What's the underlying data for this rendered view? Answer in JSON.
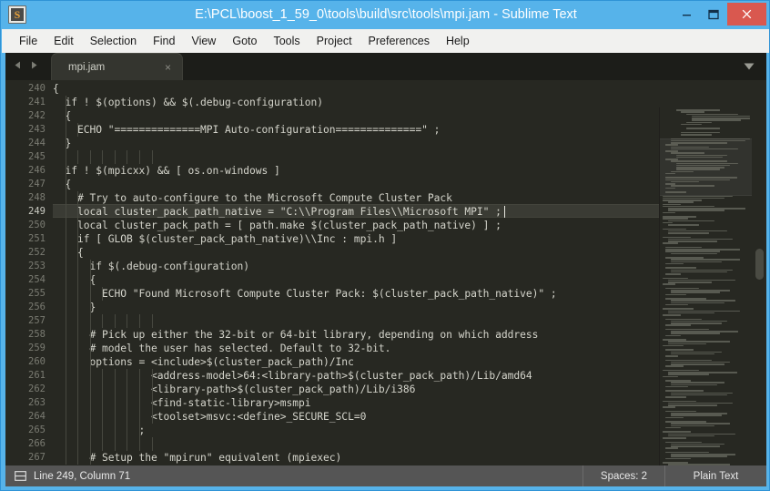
{
  "window": {
    "title": "E:\\PCL\\boost_1_59_0\\tools\\build\\src\\tools\\mpi.jam - Sublime Text",
    "app_icon_glyph": "S",
    "accent_color": "#56b3ea",
    "close_button_color": "#d9584f",
    "controls": {
      "minimize": "minimize-icon",
      "maximize": "maximize-icon",
      "close": "close-icon"
    }
  },
  "menubar": {
    "items": [
      {
        "label": "File"
      },
      {
        "label": "Edit"
      },
      {
        "label": "Selection"
      },
      {
        "label": "Find"
      },
      {
        "label": "View"
      },
      {
        "label": "Goto"
      },
      {
        "label": "Tools"
      },
      {
        "label": "Project"
      },
      {
        "label": "Preferences"
      },
      {
        "label": "Help"
      }
    ]
  },
  "tabbar": {
    "prev_icon": "triangle-left-icon",
    "next_icon": "triangle-right-icon",
    "menu_icon": "chevron-down-icon",
    "tabs": [
      {
        "label": "mpi.jam",
        "close_glyph": "×",
        "active": true
      }
    ]
  },
  "editor": {
    "first_line_number": 240,
    "active_line_number": 249,
    "background_color": "#272822",
    "text_color": "#d4d4cb",
    "lines": [
      {
        "n": 240,
        "text": "{"
      },
      {
        "n": 241,
        "text": "  if ! $(options) && $(.debug-configuration)"
      },
      {
        "n": 242,
        "text": "  {"
      },
      {
        "n": 243,
        "text": "    ECHO \"==============MPI Auto-configuration==============\" ;"
      },
      {
        "n": 244,
        "text": "  }"
      },
      {
        "n": 245,
        "text": ""
      },
      {
        "n": 246,
        "text": "  if ! $(mpicxx) && [ os.on-windows ]"
      },
      {
        "n": 247,
        "text": "  {"
      },
      {
        "n": 248,
        "text": "    # Try to auto-configure to the Microsoft Compute Cluster Pack"
      },
      {
        "n": 249,
        "text": "    local cluster_pack_path_native = \"C:\\\\Program Files\\\\Microsoft MPI\" ;"
      },
      {
        "n": 250,
        "text": "    local cluster_pack_path = [ path.make $(cluster_pack_path_native) ] ;"
      },
      {
        "n": 251,
        "text": "    if [ GLOB $(cluster_pack_path_native)\\\\Inc : mpi.h ]"
      },
      {
        "n": 252,
        "text": "    {"
      },
      {
        "n": 253,
        "text": "      if $(.debug-configuration)"
      },
      {
        "n": 254,
        "text": "      {"
      },
      {
        "n": 255,
        "text": "        ECHO \"Found Microsoft Compute Cluster Pack: $(cluster_pack_path_native)\" ;"
      },
      {
        "n": 256,
        "text": "      }"
      },
      {
        "n": 257,
        "text": ""
      },
      {
        "n": 258,
        "text": "      # Pick up either the 32-bit or 64-bit library, depending on which address"
      },
      {
        "n": 259,
        "text": "      # model the user has selected. Default to 32-bit."
      },
      {
        "n": 260,
        "text": "      options = <include>$(cluster_pack_path)/Inc"
      },
      {
        "n": 261,
        "text": "                <address-model>64:<library-path>$(cluster_pack_path)/Lib/amd64"
      },
      {
        "n": 262,
        "text": "                <library-path>$(cluster_pack_path)/Lib/i386"
      },
      {
        "n": 263,
        "text": "                <find-static-library>msmpi"
      },
      {
        "n": 264,
        "text": "                <toolset>msvc:<define>_SECURE_SCL=0"
      },
      {
        "n": 265,
        "text": "              ;"
      },
      {
        "n": 266,
        "text": ""
      },
      {
        "n": 267,
        "text": "      # Setup the \"mpirun\" equivalent (mpiexec)"
      }
    ]
  },
  "statusbar": {
    "panel_icon": "panel-layout-icon",
    "cursor_position": "Line 249, Column 71",
    "indentation": "Spaces: 2",
    "syntax": "Plain Text"
  }
}
